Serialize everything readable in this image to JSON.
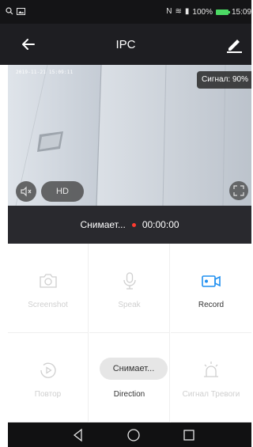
{
  "status_bar": {
    "battery": "100%",
    "time": "15:09",
    "icons": [
      "search-icon",
      "image-icon",
      "nfc-icon",
      "wifi-icon",
      "cell-signal-icon",
      "battery-icon"
    ]
  },
  "app_bar": {
    "title": "IPC",
    "back_icon": "arrow-left-icon",
    "edit_icon": "pencil-icon"
  },
  "video": {
    "timestamp": "2019-11-21 15:09:11",
    "signal": "Сигнал: 90%",
    "quality": "HD"
  },
  "recording": {
    "status": "Снимает...",
    "timer": "00:00:00",
    "dot_color": "#ff3b30"
  },
  "controls": [
    {
      "label": "Screenshot",
      "icon": "camera-icon",
      "enabled": false
    },
    {
      "label": "Speak",
      "icon": "microphone-icon",
      "enabled": false
    },
    {
      "label": "Record",
      "icon": "video-record-icon",
      "enabled": true
    },
    {
      "label": "Повтор",
      "icon": "playback-icon",
      "enabled": false
    },
    {
      "label": "Direction",
      "icon": "direction-icon",
      "enabled": true
    },
    {
      "label": "Сигнал Тревоги",
      "icon": "alarm-icon",
      "enabled": false
    }
  ],
  "toast": "Снимает...",
  "colors": {
    "accent": "#1f8ff0",
    "disabled": "#cfcfcf",
    "recording_dot": "#ff3b30"
  }
}
